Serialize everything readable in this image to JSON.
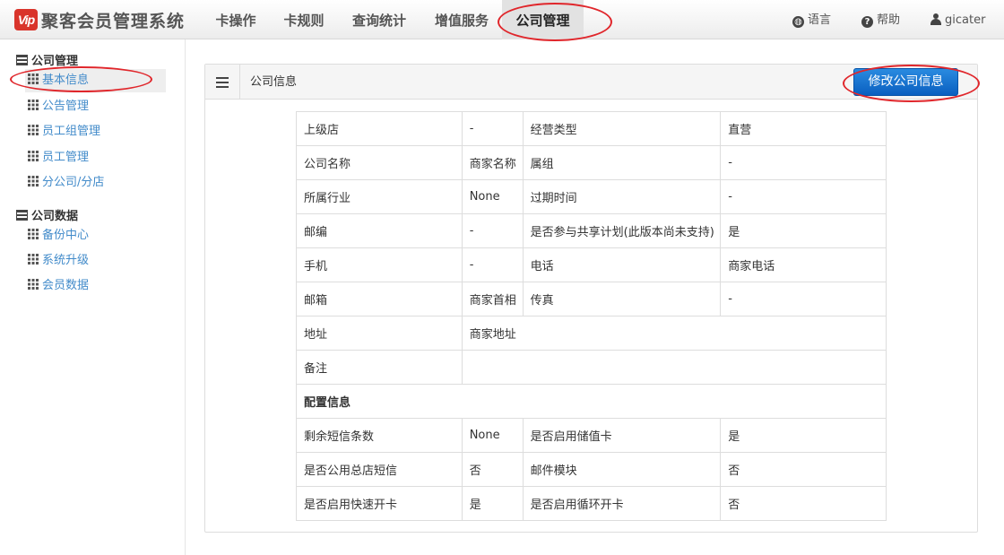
{
  "brand": {
    "logo_text": "Vip",
    "name": "聚客会员管理系统"
  },
  "nav": {
    "items": [
      {
        "label": "卡操作"
      },
      {
        "label": "卡规则"
      },
      {
        "label": "查询统计"
      },
      {
        "label": "增值服务"
      },
      {
        "label": "公司管理",
        "active": true
      }
    ],
    "language": "语言",
    "help": "帮助",
    "user": "gicater"
  },
  "sidebar": {
    "groups": [
      {
        "title": "公司管理",
        "items": [
          "基本信息",
          "公告管理",
          "员工组管理",
          "员工管理",
          "分公司/分店"
        ]
      },
      {
        "title": "公司数据",
        "items": [
          "备份中心",
          "系统升级",
          "会员数据"
        ]
      }
    ],
    "active_item": "基本信息"
  },
  "panel": {
    "title": "公司信息",
    "edit_button": "修改公司信息"
  },
  "table": {
    "rows": [
      [
        "上级店",
        "-",
        "经营类型",
        "直营"
      ],
      [
        "公司名称",
        "商家名称",
        "属组",
        "-"
      ],
      [
        "所属行业",
        "None",
        "过期时间",
        "-"
      ],
      [
        "邮编",
        "-",
        "是否参与共享计划(此版本尚未支持)",
        "是"
      ],
      [
        "手机",
        "-",
        "电话",
        "商家电话"
      ],
      [
        "邮箱",
        "商家首相",
        "传真",
        "-"
      ]
    ],
    "address_label": "地址",
    "address_value": "商家地址",
    "remark_label": "备注",
    "remark_value": "",
    "config_header": "配置信息",
    "config_rows": [
      [
        "剩余短信条数",
        "None",
        "是否启用储值卡",
        "是"
      ],
      [
        "是否公用总店短信",
        "否",
        "邮件模块",
        "否"
      ],
      [
        "是否启用快速开卡",
        "是",
        "是否启用循环开卡",
        "否"
      ]
    ]
  },
  "colors": {
    "annotation": "#e0262b",
    "link": "#428bca",
    "button": "#0a6ed1",
    "logo": "#d9342b"
  }
}
